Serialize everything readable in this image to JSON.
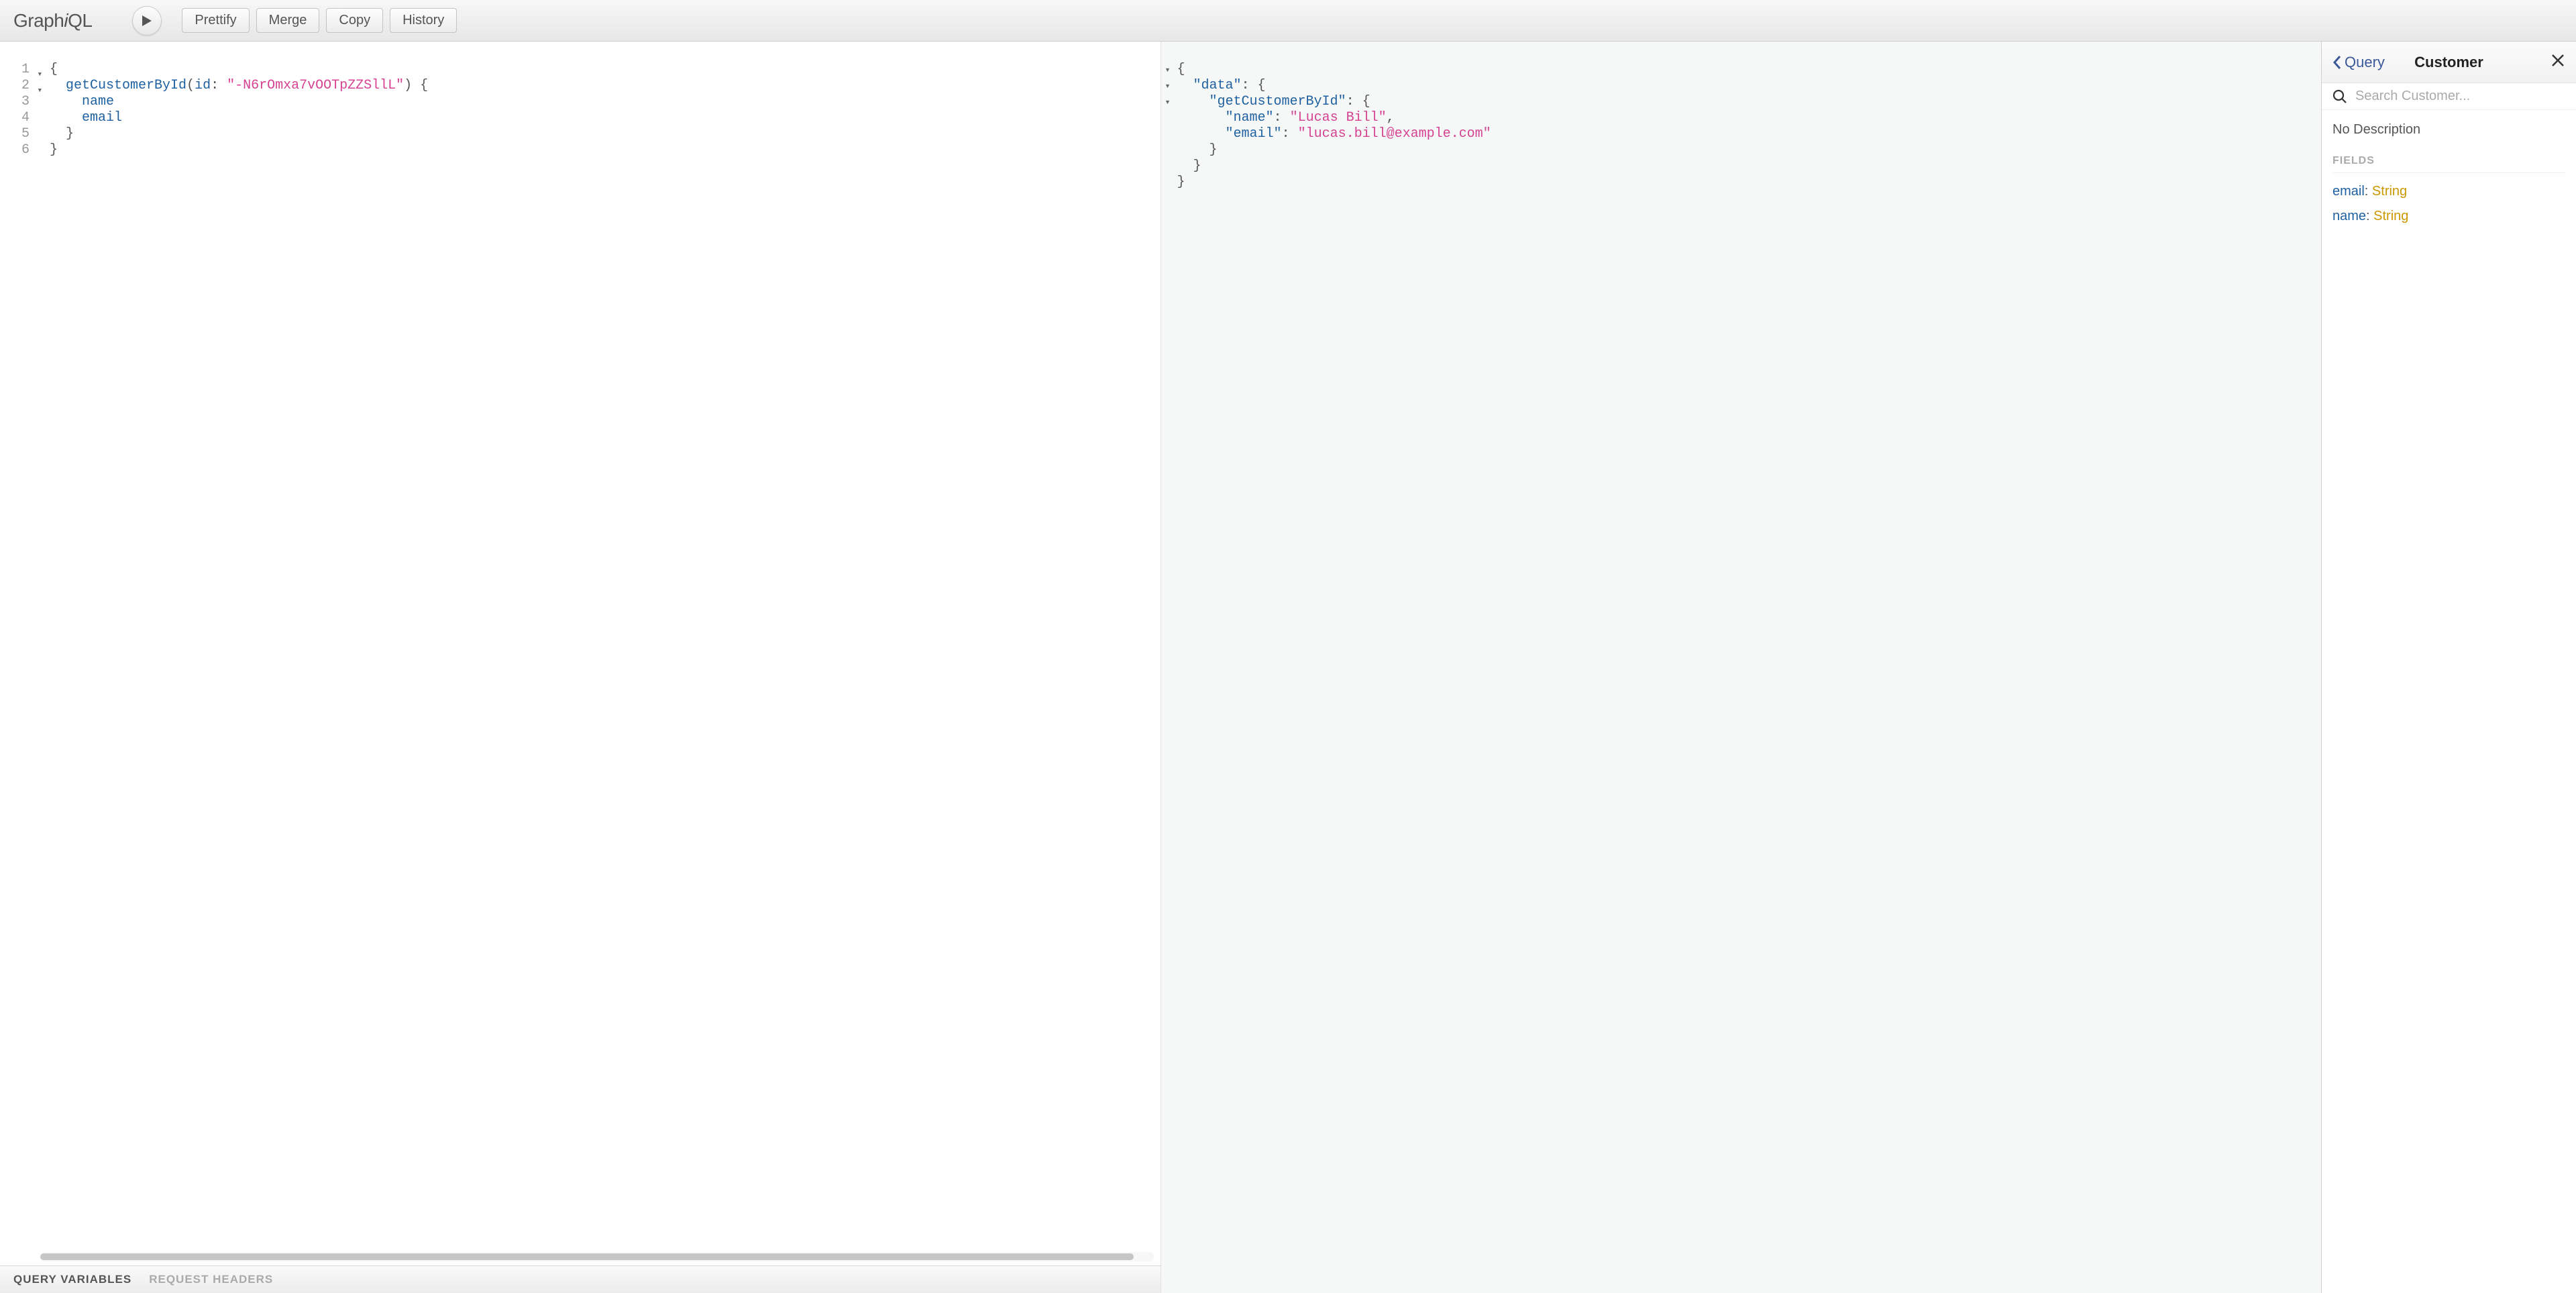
{
  "logo_pre": "Graph",
  "logo_i": "i",
  "logo_post": "QL",
  "toolbar": {
    "prettify": "Prettify",
    "merge": "Merge",
    "copy": "Copy",
    "history": "History"
  },
  "editor": {
    "line_numbers": [
      "1",
      "2",
      "3",
      "4",
      "5",
      "6"
    ],
    "fold_lines": [
      0,
      1
    ],
    "query": {
      "fn": "getCustomerById",
      "arg_name": "id",
      "arg_value": "\"-N6rOmxa7vOOTpZZSllL\"",
      "fields": [
        "name",
        "email"
      ]
    },
    "tabs": {
      "variables": "QUERY VARIABLES",
      "headers": "REQUEST HEADERS"
    }
  },
  "result": {
    "data_key": "\"data\"",
    "op_key": "\"getCustomerById\"",
    "rows": [
      {
        "key": "\"name\"",
        "value": "\"Lucas Bill\"",
        "trailing": ","
      },
      {
        "key": "\"email\"",
        "value": "\"lucas.bill@example.com\"",
        "trailing": ""
      }
    ]
  },
  "docs": {
    "back_label": "Query",
    "title": "Customer",
    "search_placeholder": "Search Customer...",
    "description": "No Description",
    "section_fields": "FIELDS",
    "fields": [
      {
        "name": "email",
        "type": "String"
      },
      {
        "name": "name",
        "type": "String"
      }
    ]
  }
}
